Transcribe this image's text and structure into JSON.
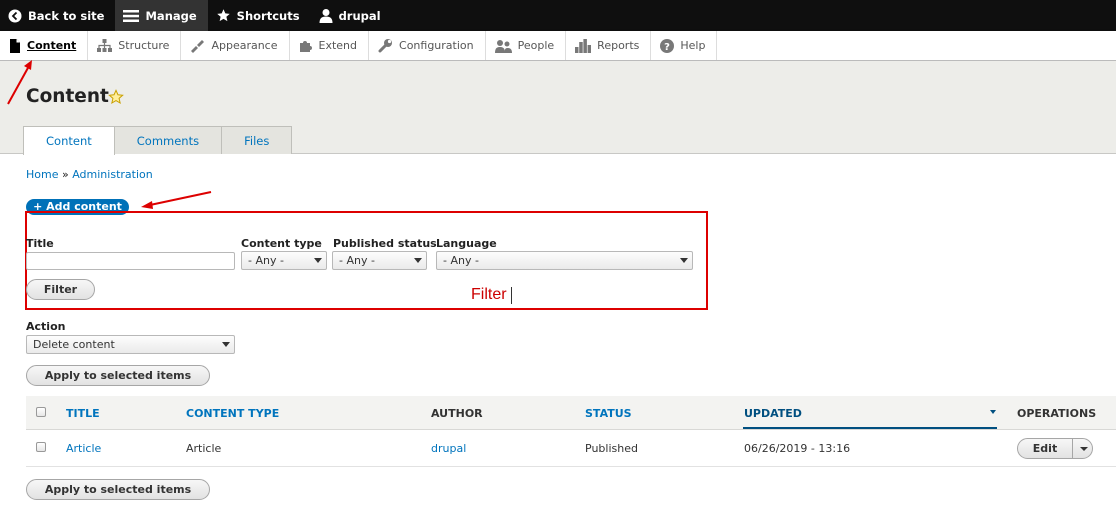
{
  "toolbar": {
    "back": "Back to site",
    "manage": "Manage",
    "shortcuts": "Shortcuts",
    "user": "drupal"
  },
  "tray": {
    "items": [
      "Content",
      "Structure",
      "Appearance",
      "Extend",
      "Configuration",
      "People",
      "Reports",
      "Help"
    ]
  },
  "page": {
    "title": "Content"
  },
  "tabs": [
    "Content",
    "Comments",
    "Files"
  ],
  "breadcrumb": {
    "home": "Home",
    "separator": "»",
    "admin": "Administration"
  },
  "add_content": "+ Add content",
  "filters": {
    "title_label": "Title",
    "content_type_label": "Content type",
    "content_type_value": "- Any -",
    "published_label": "Published status",
    "published_value": "- Any -",
    "language_label": "Language",
    "language_value": "- Any -",
    "filter_button": "Filter",
    "annotation": "Filter"
  },
  "bulk": {
    "action_label": "Action",
    "action_value": "Delete content",
    "apply_button": "Apply to selected items"
  },
  "table": {
    "headers": [
      "TITLE",
      "CONTENT TYPE",
      "AUTHOR",
      "STATUS",
      "UPDATED",
      "OPERATIONS"
    ],
    "rows": [
      {
        "title": "Article",
        "type": "Article",
        "author": "drupal",
        "status": "Published",
        "updated": "06/26/2019 - 13:16",
        "operation": "Edit"
      }
    ]
  },
  "colors": {
    "link": "#0074bd",
    "primary_button": "#0071b8",
    "annotation": "#dd0000",
    "toolbar": "#0f0f0f"
  },
  "icons": {
    "back": "drupal-drop-icon",
    "manage": "hamburger-icon",
    "shortcuts": "star-icon",
    "user": "person-icon"
  }
}
